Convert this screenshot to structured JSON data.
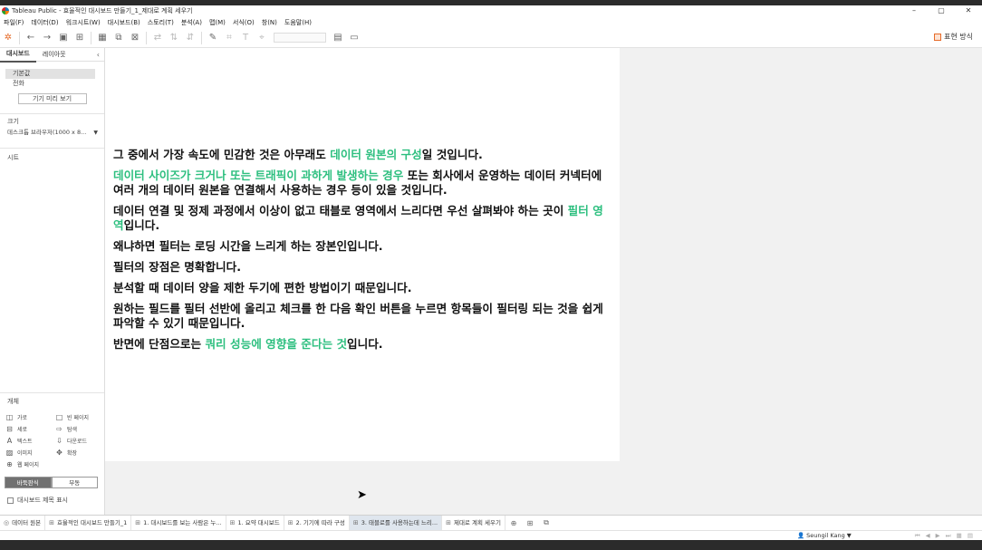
{
  "window": {
    "title": "Tableau Public - 효율적인 대시보드 만들기_1_제대로 계획 세우기",
    "controls": [
      "–",
      "▢",
      "✕"
    ]
  },
  "menu": [
    "파일(F)",
    "데이터(D)",
    "워크시트(W)",
    "대시보드(B)",
    "스토리(T)",
    "분석(A)",
    "맵(M)",
    "서식(O)",
    "창(N)",
    "도움말(H)"
  ],
  "toolbar": {
    "present_label": "표현 방식"
  },
  "sidebar": {
    "tabs": [
      "대시보드",
      "레이아웃"
    ],
    "collapse": "‹",
    "devices": [
      "기본값",
      "전화"
    ],
    "preview_button": "기기 미리 보기",
    "size_label": "크기",
    "size_value": "데스크톱 브라우저(1000 x 8...",
    "sheets_label": "시트",
    "objects_label": "개체",
    "objects": [
      "가로",
      "빈 페이지",
      "세로",
      "탐색",
      "텍스트",
      "다운로드",
      "이미지",
      "확장",
      "웹 페이지"
    ],
    "float_toggle": [
      "바둑판식",
      "부동"
    ],
    "show_title": "대시보드 제목 표시"
  },
  "content": {
    "p1": {
      "before": "그 중에서 가장 속도에 민감한 것은 아무래도 ",
      "hl": "데이터 원본의 구성",
      "after": "일 것입니다."
    },
    "p2": {
      "hl": "데이터 사이즈가 크거나 또는 트래픽이 과하게 발생하는 경우",
      "after": " 또는 회사에서 운영하는 데이터 커넥터에 여러 개의 데이터 원본을 연결해서 사용하는 경우 등이 있을 것입니다."
    },
    "p3": {
      "before": "데이터 연결 및 정제 과정에서 이상이 없고 태블로 영역에서 느리다면 우선 살펴봐야 하는 곳이 ",
      "hl": "필터 영역",
      "after": "입니다."
    },
    "p4": "왜냐하면 필터는 로딩 시간을 느리게 하는 장본인입니다.",
    "p5": "필터의 장점은 명확합니다.",
    "p6": "분석할 때 데이터 양을 제한 두기에 편한 방법이기 때문입니다.",
    "p7": "원하는 필드를 필터 선반에 올리고 체크를 한 다음 확인 버튼을 누르면 항목들이 필터링 되는 것을 쉽게 파악할 수 있기 때문입니다.",
    "p8": {
      "before": "반면에 단점으로는 ",
      "hl": "쿼리 성능에 영향을 준다는 것",
      "after": "입니다."
    }
  },
  "sheet_tabs": [
    "데이터 원본",
    "효율적인 대시보드 만들기_1",
    "1. 대시보드를 보는 사람은 누...",
    "1. 요약 대시보드",
    "2. 기기에 따라 구성",
    "3. 태블로를 사용하는데 느리...",
    "제대로 계획 세우기"
  ],
  "status": {
    "user": "Seungil Kang",
    "user_caret": "▼",
    "nav": "⏮ ◀ ▶ ⏭ ▦ ▤"
  },
  "colors": {
    "highlight": "#2dbf7f"
  }
}
